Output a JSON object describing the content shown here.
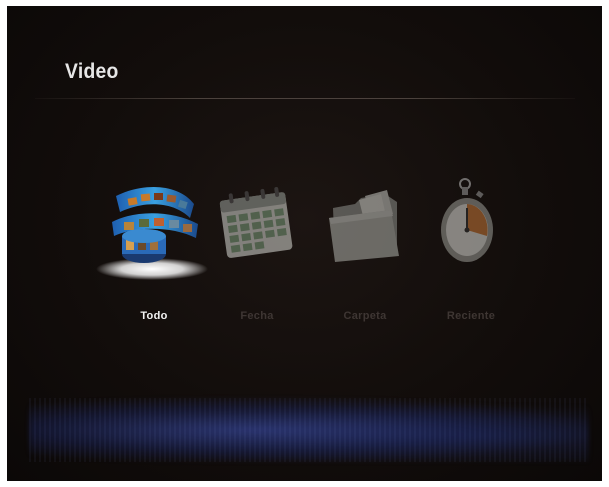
{
  "screen": {
    "title": "Video"
  },
  "menu": {
    "items": [
      {
        "label": "Todo",
        "icon": "film-reel-icon",
        "selected": true
      },
      {
        "label": "Fecha",
        "icon": "calendar-icon",
        "selected": false
      },
      {
        "label": "Carpeta",
        "icon": "folder-icon",
        "selected": false
      },
      {
        "label": "Reciente",
        "icon": "stopwatch-icon",
        "selected": false
      }
    ]
  },
  "colors": {
    "background": "#120d0b",
    "title_text": "#e6e6e6",
    "selected_label": "#f2f2f2",
    "unselected_label": "#3e3633",
    "bottom_glow": "#3c50b4"
  }
}
